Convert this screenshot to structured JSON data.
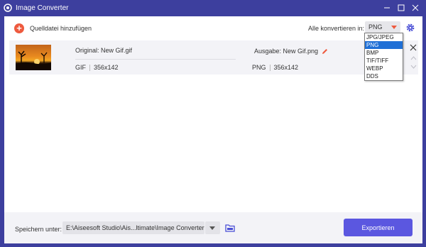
{
  "window": {
    "title": "Image Converter",
    "icons": {
      "logo": "app-logo-icon",
      "minimize": "minimize-icon",
      "maximize": "maximize-icon",
      "close": "close-icon"
    }
  },
  "toolbar": {
    "add_label": "Quelldatei hinzufügen",
    "add_icon": "plus-circle-icon",
    "convert_all_label": "Alle konvertieren in:",
    "selected_format": "PNG",
    "settings_icon": "gear-icon"
  },
  "format_dropdown": {
    "options": [
      "JPG/JPEG",
      "PNG",
      "BMP",
      "TIF/TIFF",
      "WEBP",
      "DDS"
    ],
    "highlighted": "PNG"
  },
  "file": {
    "original_name": "Original: New Gif.gif",
    "original_format": "GIF",
    "original_size": "356x142",
    "output_name": "Ausgabe: New Gif.png",
    "output_format": "PNG",
    "output_size": "356x142",
    "thumbnail": "sunset-thumbnail"
  },
  "bottom": {
    "save_label": "Speichern unter:",
    "path": "E:\\Aiseesoft Studio\\Ais...ltimate\\Image Converter",
    "export_label": "Exportieren"
  },
  "colors": {
    "titlebar": "#3d3f9e",
    "accent": "#ee5a3e",
    "export_button": "#5b57e0",
    "selection": "#1f6fd6"
  }
}
